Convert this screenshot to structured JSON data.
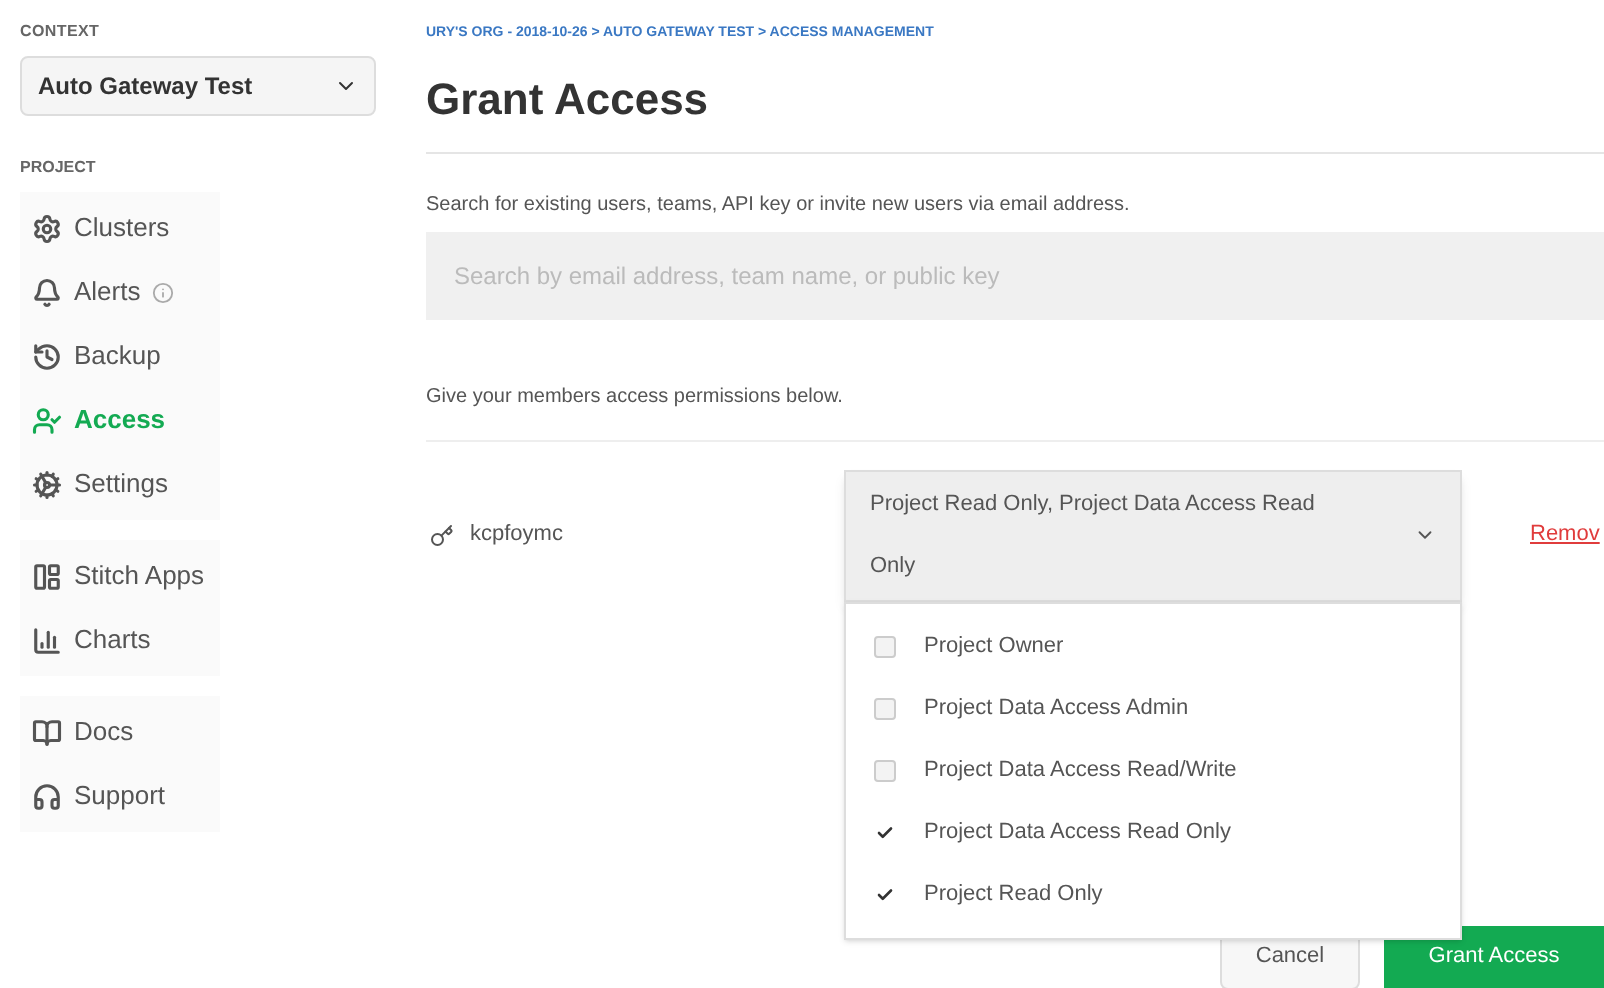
{
  "sidebar": {
    "context_label": "CONTEXT",
    "context_select": "Auto Gateway Test",
    "project_label": "PROJECT",
    "sections": [
      [
        {
          "label": "Clusters",
          "selected": false,
          "info": false
        },
        {
          "label": "Alerts",
          "selected": false,
          "info": true
        },
        {
          "label": "Backup",
          "selected": false,
          "info": false
        },
        {
          "label": "Access",
          "selected": true,
          "info": false
        },
        {
          "label": "Settings",
          "selected": false,
          "info": false
        }
      ],
      [
        {
          "label": "Stitch Apps",
          "selected": false,
          "info": false
        },
        {
          "label": "Charts",
          "selected": false,
          "info": false
        }
      ],
      [
        {
          "label": "Docs",
          "selected": false,
          "info": false
        },
        {
          "label": "Support",
          "selected": false,
          "info": false
        }
      ]
    ]
  },
  "breadcrumb": "URY'S ORG - 2018-10-26 > AUTO GATEWAY TEST > ACCESS MANAGEMENT",
  "title": "Grant Access",
  "search": {
    "help": "Search for existing users, teams, API key or invite new users via email address.",
    "placeholder": "Search by email address, team name, or public key"
  },
  "permissions_help": "Give your members access permissions below.",
  "member": {
    "name": "kcpfoymc",
    "roles_value": "Project Read Only, Project Data Access Read Only",
    "expanded": true,
    "remove": "Remov"
  },
  "roles": [
    {
      "label": "Project Owner",
      "checked": false
    },
    {
      "label": "Project Data Access Admin",
      "checked": false
    },
    {
      "label": "Project Data Access Read/Write",
      "checked": false
    },
    {
      "label": "Project Data Access Read Only",
      "checked": true
    },
    {
      "label": "Project Read Only",
      "checked": true
    }
  ],
  "buttons": {
    "cancel": "Cancel",
    "grant": "Grant Access"
  }
}
